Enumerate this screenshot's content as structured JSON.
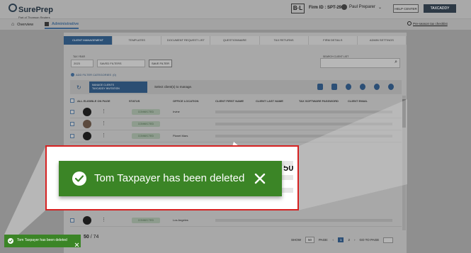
{
  "header": {
    "logo_text": "SurePrep",
    "logo_sub": "Part of Thomson Reuters",
    "bl_badge": "B·L",
    "firm_id": "Firm ID : SPT-29",
    "user_name": "Paul Preparer",
    "help_label": "HELP CENTER",
    "taxcaddy_label": "TAXCADDY"
  },
  "subnav": {
    "overview": "Overview",
    "administrative": "Administrative",
    "checklist": "Pre-season tax checklist"
  },
  "tabs": [
    {
      "label": "CLIENT MANAGEMENT"
    },
    {
      "label": "TEMPLATES"
    },
    {
      "label": "DOCUMENT REQUEST LIST"
    },
    {
      "label": "QUESTIONNAIRE"
    },
    {
      "label": "TAX RETURNS"
    },
    {
      "label": "FIRM DETAILS"
    },
    {
      "label": "ADMIN SETTINGS"
    }
  ],
  "filters": {
    "tax_year_label": "TAX YEAR",
    "tax_year_value": "2023",
    "saved_filters": "SAVED FILTERS",
    "save_filter": "SAVE FILTER",
    "search_label": "SEARCH CLIENT LIST",
    "add_filter": "ADD FILTER CATEGORIES",
    "add_filter_count": "(0)"
  },
  "toolbar": {
    "manage_label": "MANAGE CLIENTS",
    "manage_value": "TAXCADDY INVITATION",
    "hint": "Select client(s) to manage."
  },
  "grid": {
    "headers": [
      "ALL ELIGIBLE ON PAGE",
      "STATUS",
      "OFFICE LOCATION",
      "CLIENT FIRST NAME",
      "CLIENT LAST NAME",
      "TAX SOFTWARE PASSWORD",
      "CLIENT EMAIL"
    ],
    "rows": [
      {
        "status": "CONNECTED",
        "location": "Irvine"
      },
      {
        "status": "CONNECTED",
        "location": ""
      },
      {
        "status": "CONNECTED",
        "location": "Planet Mars"
      },
      {
        "status": "CONNECTED",
        "location": "Los Angeles"
      }
    ]
  },
  "pager": {
    "show_label": "SHOW",
    "show_value": "50",
    "page_label": "PAGE:",
    "pages": [
      "1",
      "2"
    ],
    "goto_label": "GO TO PAGE",
    "count_shown": "50",
    "count_total": "/ 74"
  },
  "callout": {
    "count": "50",
    "toast_message": "Tom Taxpayer has been deleted"
  },
  "small_toast": {
    "message": "Tom Taxpayer has been deleted"
  },
  "colors": {
    "toast_green": "#3b8526",
    "callout_border": "#d62121",
    "primary_blue": "#2c5177"
  }
}
